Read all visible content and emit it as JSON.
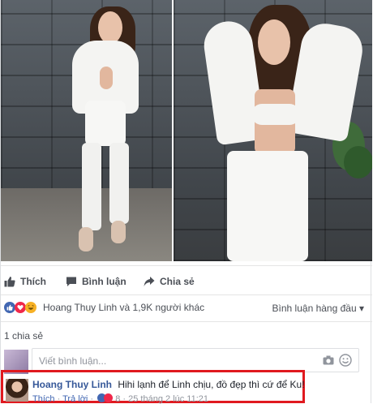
{
  "actions": {
    "like": "Thích",
    "comment": "Bình luận",
    "share": "Chia sẻ"
  },
  "reactions": {
    "summary": "Hoang Thuy Linh và 1,9K người khác",
    "sort_label": "Bình luận hàng đầu",
    "sort_caret": "▾"
  },
  "shares": {
    "text": "1 chia sẻ"
  },
  "comment_input": {
    "placeholder": "Viết bình luận..."
  },
  "highlight_comment": {
    "author": "Hoang Thuy Linh",
    "text": "Hihi lạnh để Linh chịu, đồ đẹp thì cứ để Ku!",
    "like_link": "Thích",
    "reply_link": "Trả lời",
    "reaction_count": "8",
    "timestamp": "25 tháng 2 lúc 11:21"
  },
  "colors": {
    "link": "#365899",
    "accent": "#4267b2",
    "love": "#f0284a",
    "highlight_border": "#e0191f"
  }
}
